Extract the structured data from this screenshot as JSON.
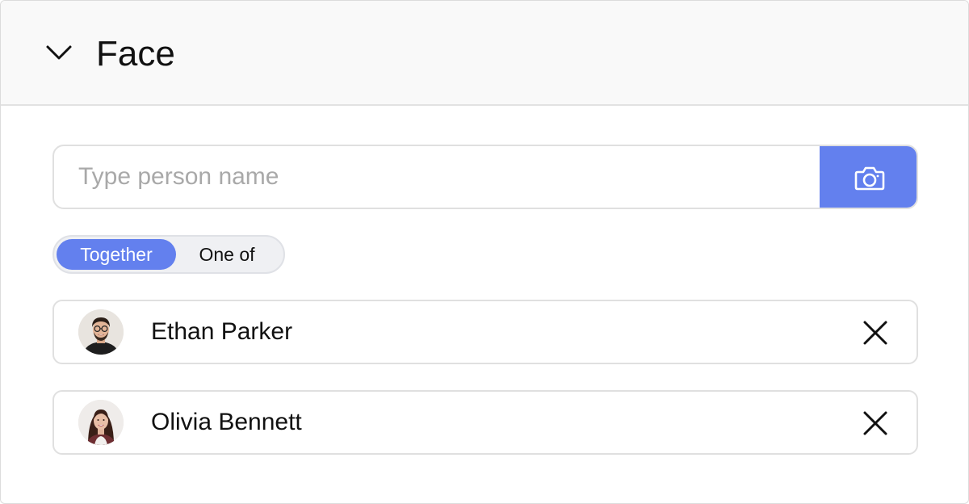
{
  "section": {
    "title": "Face",
    "expanded": true
  },
  "search": {
    "placeholder": "Type person name",
    "value": "",
    "button_icon": "camera-icon",
    "accent_color": "#6380ee"
  },
  "match_mode": {
    "options": [
      "Together",
      "One of"
    ],
    "selected": "Together"
  },
  "people": [
    {
      "name": "Ethan Parker",
      "avatar": "avatar-man-glasses",
      "remove_icon": "close-icon"
    },
    {
      "name": "Olivia Bennett",
      "avatar": "avatar-woman-dark-hair",
      "remove_icon": "close-icon"
    }
  ]
}
